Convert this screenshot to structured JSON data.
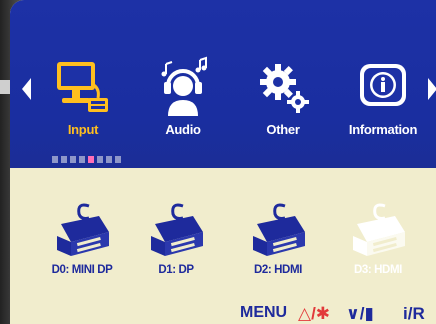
{
  "menu": {
    "items": [
      {
        "label": "Input",
        "icon": "computer-input-icon",
        "active": true
      },
      {
        "label": "Audio",
        "icon": "headphones-person-icon",
        "active": false
      },
      {
        "label": "Other",
        "icon": "gears-icon",
        "active": false
      },
      {
        "label": "Information",
        "icon": "info-icon",
        "active": false
      }
    ],
    "page_indicator": {
      "total": 8,
      "active_index": 4
    }
  },
  "inputs": [
    {
      "label": "D0: MINI DP",
      "icon": "connector-icon",
      "enabled": true
    },
    {
      "label": "D1: DP",
      "icon": "connector-icon",
      "enabled": true
    },
    {
      "label": "D2: HDMI",
      "icon": "connector-icon",
      "enabled": true
    },
    {
      "label": "D3: HDMI",
      "icon": "connector-icon",
      "enabled": false
    }
  ],
  "keys": {
    "menu": "MENU",
    "up": "△/✱",
    "down": "∨/▮",
    "ir": "i/R"
  },
  "colors": {
    "topbar": "#1b2fa0",
    "panel": "#f1edcd",
    "active_label": "#ffbf1f",
    "port_label": "#1e2a9c",
    "indicator_on": "#ff6fb6"
  }
}
